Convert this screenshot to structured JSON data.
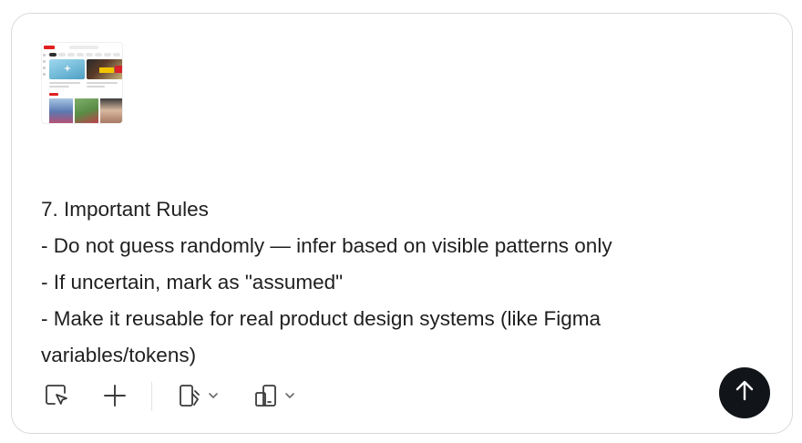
{
  "attachment": {
    "kind": "screenshot-thumbnail"
  },
  "message": {
    "lines": [
      "7. Important Rules",
      "- Do not guess randomly — infer based on visible patterns only",
      "- If uncertain, mark as \"assumed\"",
      "- Make it reusable for real product design systems (like Figma",
      "variables/tokens)"
    ]
  },
  "toolbar": {
    "icons": [
      "cursor-select-icon",
      "plus-icon",
      "device-edit-icon",
      "chevron-down-icon",
      "tablet-phone-icon",
      "chevron-down-icon"
    ]
  },
  "send": {
    "icon": "arrow-up-icon"
  },
  "colors": {
    "send_bg": "#111418",
    "text": "#1f1f1f",
    "border": "#d9d9d9"
  }
}
